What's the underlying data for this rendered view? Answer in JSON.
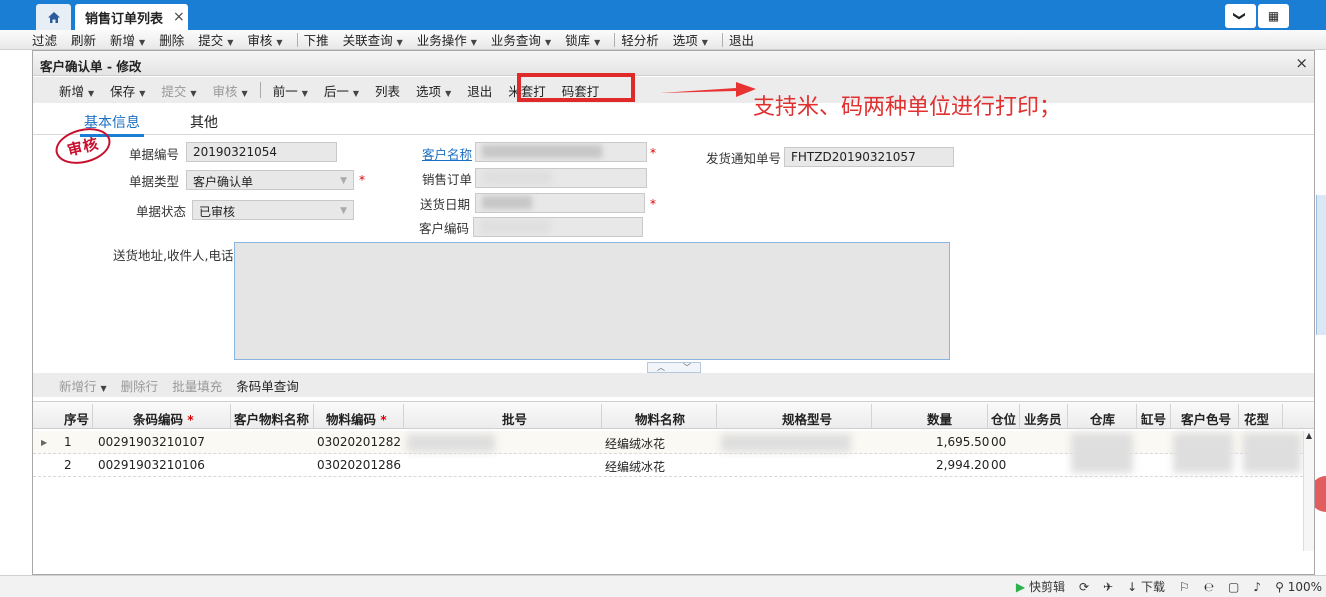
{
  "topbar": {
    "active_tab": "销售订单列表",
    "close_glyph": "×",
    "home_icon": "home-icon",
    "chevron_glyph": "❯",
    "grid_glyph": "▦"
  },
  "menubar": {
    "items": [
      {
        "label": "过滤"
      },
      {
        "label": "刷新"
      },
      {
        "label": "新增",
        "dropdown": true
      },
      {
        "label": "删除"
      },
      {
        "label": "提交",
        "dropdown": true
      },
      {
        "label": "审核",
        "dropdown": true
      },
      {
        "label": "下推"
      },
      {
        "label": "关联查询",
        "dropdown": true
      },
      {
        "label": "业务操作",
        "dropdown": true
      },
      {
        "label": "业务查询",
        "dropdown": true
      },
      {
        "label": "锁库",
        "dropdown": true
      },
      {
        "label": "轻分析"
      },
      {
        "label": "选项",
        "dropdown": true
      },
      {
        "label": "退出"
      }
    ]
  },
  "dialog": {
    "title": "客户确认单 - 修改",
    "close_glyph": "×",
    "toolbar": {
      "new": "新增",
      "save": "保存",
      "submit": "提交",
      "audit": "审核",
      "prev": "前一",
      "next": "后一",
      "list": "列表",
      "options": "选项",
      "exit": "退出",
      "meter_print": "米套打",
      "yard_print": "码套打"
    },
    "annotation": "支持米、码两种单位进行打印；",
    "tabs": {
      "basic": "基本信息",
      "other": "其他"
    },
    "stamp": "审核",
    "form": {
      "doc_no_label": "单据编号",
      "doc_no": "20190321054",
      "doc_type_label": "单据类型",
      "doc_type": "客户确认单",
      "doc_status_label": "单据状态",
      "doc_status": "已审核",
      "customer_label": "客户名称",
      "sales_order_label": "销售订单",
      "delivery_date_label": "送货日期",
      "customer_code_label": "客户编码",
      "ship_notice_label": "发货通知单号",
      "ship_notice": "FHTZD20190321057",
      "address_label": "送货地址,收件人,电话",
      "required_mark": "*"
    },
    "collapse": {
      "up": "︿",
      "down": "﹀"
    },
    "subtoolbar": {
      "add_row": "新增行",
      "delete_row": "删除行",
      "batch_fill": "批量填充",
      "barcode_query": "条码单查询"
    },
    "grid": {
      "headers": {
        "seq": "序号",
        "barcode": "条码编码",
        "cust_material": "客户物料名称",
        "material_code": "物料编码",
        "batch": "批号",
        "material_name": "物料名称",
        "spec": "规格型号",
        "qty": "数量",
        "location": "仓位",
        "salesman": "业务员",
        "warehouse": "仓库",
        "vat": "缸号",
        "cust_color": "客户色号",
        "pattern": "花型"
      },
      "rows": [
        {
          "seq": "1",
          "barcode": "00291903210107",
          "material_code": "03020201282",
          "material_name": "经编绒冰花",
          "qty": "1,695.50",
          "location": "00"
        },
        {
          "seq": "2",
          "barcode": "00291903210106",
          "material_code": "03020201286",
          "material_name": "经编绒冰花",
          "qty": "2,994.20",
          "location": "00"
        }
      ]
    }
  },
  "statusbar": {
    "clip": "快剪辑",
    "download": "下载",
    "zoom": "100%"
  },
  "colors": {
    "accent": "#1a7fd4",
    "required": "#dd0000",
    "annotation": "#e03030"
  }
}
